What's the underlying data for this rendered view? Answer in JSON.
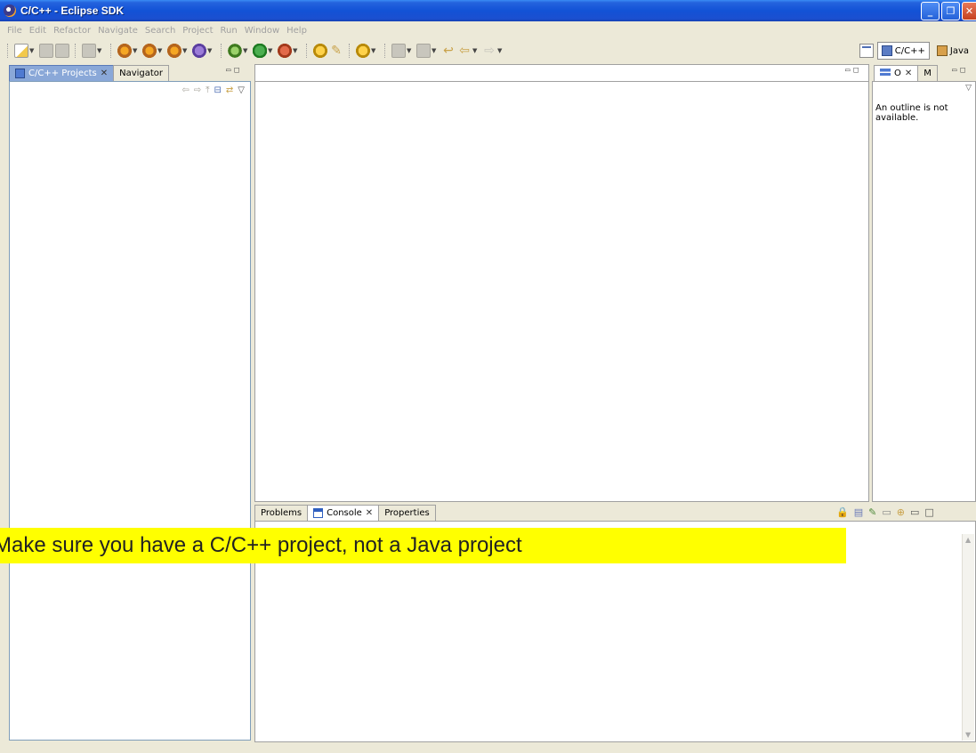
{
  "window": {
    "title": "C/C++ - Eclipse SDK"
  },
  "menu": [
    "File",
    "Edit",
    "Refactor",
    "Navigate",
    "Search",
    "Project",
    "Run",
    "Window",
    "Help"
  ],
  "perspectives": {
    "active": "C/C++",
    "other": "Java"
  },
  "left_panel": {
    "tabs": [
      {
        "label": "C/C++ Projects",
        "active": true
      },
      {
        "label": "Navigator",
        "active": false
      }
    ]
  },
  "outline_panel": {
    "tabs": [
      "O",
      "M"
    ],
    "message": "An outline is not available."
  },
  "bottom_panel": {
    "tabs": [
      "Problems",
      "Console",
      "Properties"
    ]
  },
  "banner": {
    "text": "Make sure you have a C/C++ project, not a Java project",
    "color": "#ffff00"
  }
}
